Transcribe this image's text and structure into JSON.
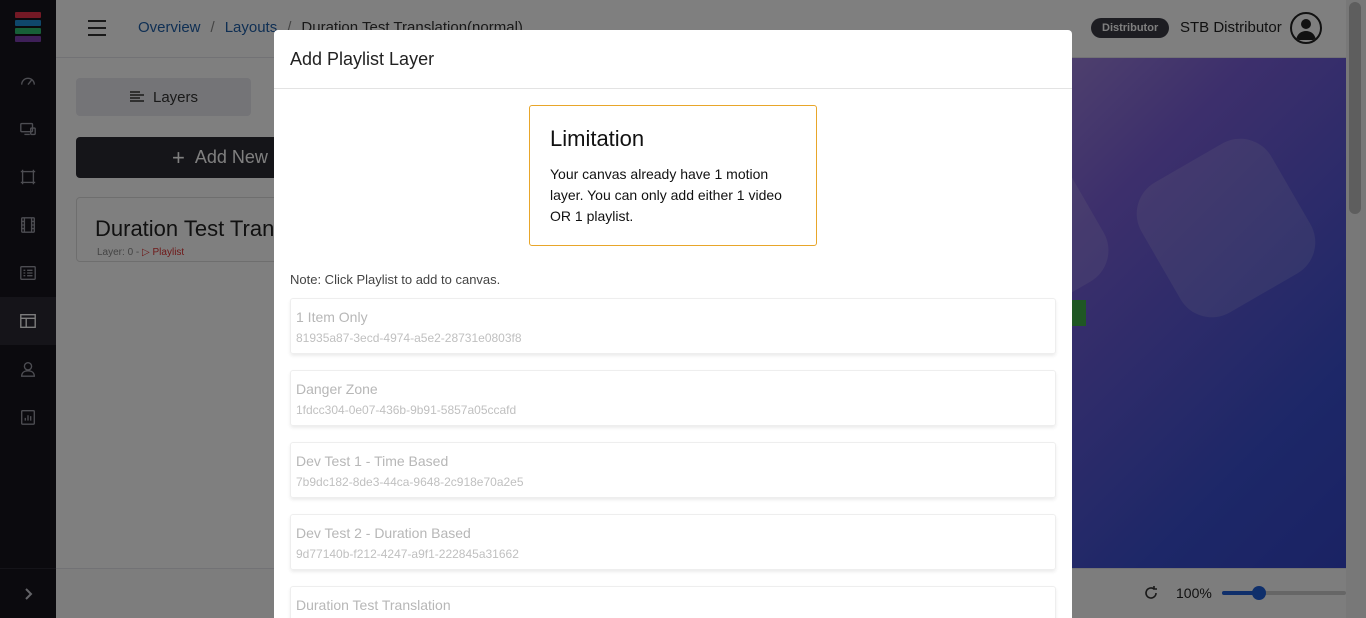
{
  "app": {
    "logo_colors": [
      "#e8334a",
      "#1f8fd6",
      "#2fbf71",
      "#7d3fb0"
    ]
  },
  "sidebar": {
    "items": [
      {
        "icon": "gauge-icon"
      },
      {
        "icon": "devices-icon"
      },
      {
        "icon": "screen-frame-icon"
      },
      {
        "icon": "film-icon"
      },
      {
        "icon": "list-card-icon"
      },
      {
        "icon": "layout-icon",
        "active": true
      },
      {
        "icon": "users-icon"
      },
      {
        "icon": "report-icon"
      }
    ],
    "toggle_icon": "chevron-right-icon"
  },
  "header": {
    "breadcrumb": [
      "Overview",
      "Layouts",
      "Duration Test Translation(normal)"
    ],
    "role_badge": "Distributor",
    "user_name": "STB Distributor"
  },
  "panel": {
    "layers_label": "Layers",
    "add_new_label": "Add New",
    "layer_card": {
      "name": "Duration Test Translation(normal)",
      "meta_prefix": "Layer: 0 -",
      "meta_type": "Playlist"
    }
  },
  "footer": {
    "zoom": "100%",
    "zoom_level": 0.3
  },
  "modal": {
    "title": "Add Playlist Layer",
    "limitation": {
      "title": "Limitation",
      "text": "Your canvas already have 1 motion layer. You can only add either 1 video OR 1 playlist."
    },
    "note": "Note: Click Playlist to add to canvas.",
    "playlists": [
      {
        "name": "1 Item Only",
        "id": "81935a87-3ecd-4974-a5e2-28731e0803f8"
      },
      {
        "name": "Danger Zone",
        "id": "1fdcc304-0e07-436b-9b91-5857a05ccafd"
      },
      {
        "name": "Dev Test 1 - Time Based",
        "id": "7b9dc182-8de3-44ca-9648-2c918e70a2e5"
      },
      {
        "name": "Dev Test 2 - Duration Based",
        "id": "9d77140b-f212-4247-a9f1-222845a31662"
      },
      {
        "name": "Duration Test Translation",
        "id": ""
      }
    ]
  }
}
